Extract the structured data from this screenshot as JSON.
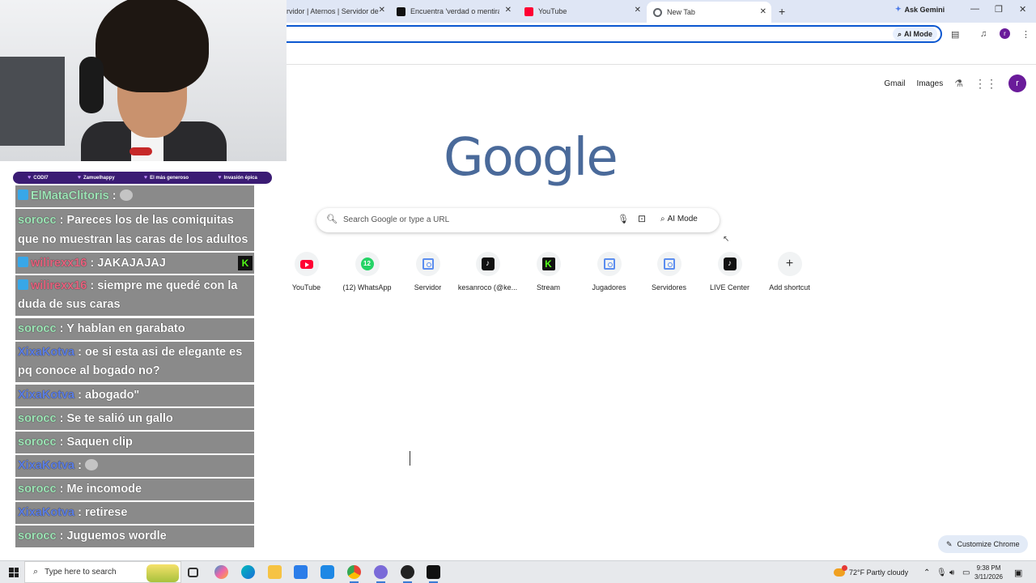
{
  "browser": {
    "tabs": [
      {
        "label": "rvidor | Aternos | Servidor de",
        "icon": "aternos-icon"
      },
      {
        "label": "Encuentra 'verdad o mentira m",
        "icon": "tiktok-icon"
      },
      {
        "label": "YouTube",
        "icon": "youtube-icon"
      },
      {
        "label": "New Tab",
        "icon": "chrome-icon",
        "active": true
      }
    ],
    "ask_gemini": "Ask Gemini",
    "omnibox_ai_mode": "AI Mode",
    "profile_initial": "r"
  },
  "ntp": {
    "top_links": {
      "gmail": "Gmail",
      "images": "Images"
    },
    "avatar_initial": "r",
    "logo": "Google",
    "search_placeholder": "Search Google or type a URL",
    "ai_mode": "AI Mode",
    "shortcuts": [
      {
        "label": "YouTube",
        "icon": "youtube-icon"
      },
      {
        "label": "(12) WhatsApp",
        "icon": "whatsapp-icon",
        "badge": "12"
      },
      {
        "label": "Servidor",
        "icon": "globe-icon"
      },
      {
        "label": "kesanroco (@ke...",
        "icon": "tiktok-icon"
      },
      {
        "label": "Stream",
        "icon": "kick-icon"
      },
      {
        "label": "Jugadores",
        "icon": "globe-icon"
      },
      {
        "label": "Servidores",
        "icon": "globe-icon"
      },
      {
        "label": "LIVE Center",
        "icon": "tiktok-icon"
      },
      {
        "label": "Add shortcut",
        "icon": "plus-icon"
      }
    ],
    "customize": "Customize Chrome"
  },
  "stream": {
    "subs": [
      "CODI7",
      "Zamuelhappy",
      "El más generoso",
      "Invasión épica"
    ],
    "chat": [
      {
        "user": "ElMataClitoris",
        "sep": " : ",
        "text": "",
        "emote": true,
        "color": "green",
        "badge": true
      },
      {
        "user": "sorocc",
        "sep": " : ",
        "text": "Pareces los de las comiquitas que no muestran las caras de los adultos",
        "color": "green"
      },
      {
        "user": "wilirexx16",
        "sep": " : ",
        "text": "JAKAJAJAJ",
        "color": "red",
        "badge": true,
        "kick": true
      },
      {
        "user": "wilirexx16",
        "sep": " : ",
        "text": "siempre me quedé con la duda de sus caras",
        "color": "red",
        "badge": true
      },
      {
        "user": "sorocc",
        "sep": " : ",
        "text": "Y hablan en garabato",
        "color": "green"
      },
      {
        "user": "XixaKotva",
        "sep": " : ",
        "text": "oe si esta asi de elegante es pq conoce al bogado no?",
        "color": "blue"
      },
      {
        "user": "XixaKotva",
        "sep": " : ",
        "text": "abogado\"",
        "color": "blue"
      },
      {
        "user": "sorocc",
        "sep": " : ",
        "text": "Se te salió un gallo",
        "color": "green"
      },
      {
        "user": "sorocc",
        "sep": " : ",
        "text": "Saquen clip",
        "color": "green"
      },
      {
        "user": "XixaKotva",
        "sep": " : ",
        "text": "",
        "emote": true,
        "color": "blue"
      },
      {
        "user": "sorocc",
        "sep": " : ",
        "text": "Me incomode",
        "color": "green"
      },
      {
        "user": "XixaKotva",
        "sep": " : ",
        "text": "retirese",
        "color": "blue"
      },
      {
        "user": "sorocc",
        "sep": " : ",
        "text": "Juguemos wordle",
        "color": "green"
      }
    ],
    "kick_letter": "K"
  },
  "taskbar": {
    "search_placeholder": "Type here to search",
    "weather": "72°F  Partly cloudy",
    "time": "9:38 PM",
    "date": "3/11/2026"
  }
}
